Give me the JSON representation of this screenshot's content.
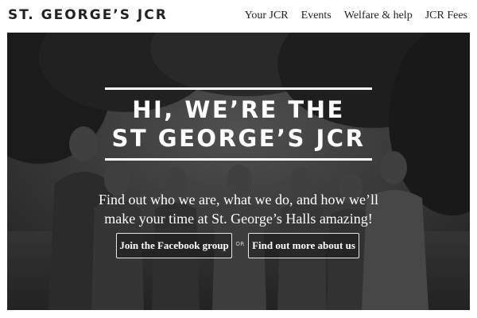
{
  "header": {
    "site_title": "ST. GEORGE’S JCR",
    "nav": [
      {
        "label": "Your JCR"
      },
      {
        "label": "Events"
      },
      {
        "label": "Welfare & help"
      },
      {
        "label": "JCR Fees"
      }
    ]
  },
  "hero": {
    "photo_description": "black-and-white group photo",
    "headline_line1": "HI, WE’RE THE",
    "headline_line2": "ST GEORGE’S JCR",
    "subtext_line1": "Find out who we are, what we do, and how we’ll",
    "subtext_line2": "make your time at St. George’s Halls amazing!",
    "cta_facebook": "Join the Facebook group",
    "cta_or": "OR",
    "cta_about": "Find out more about us"
  }
}
